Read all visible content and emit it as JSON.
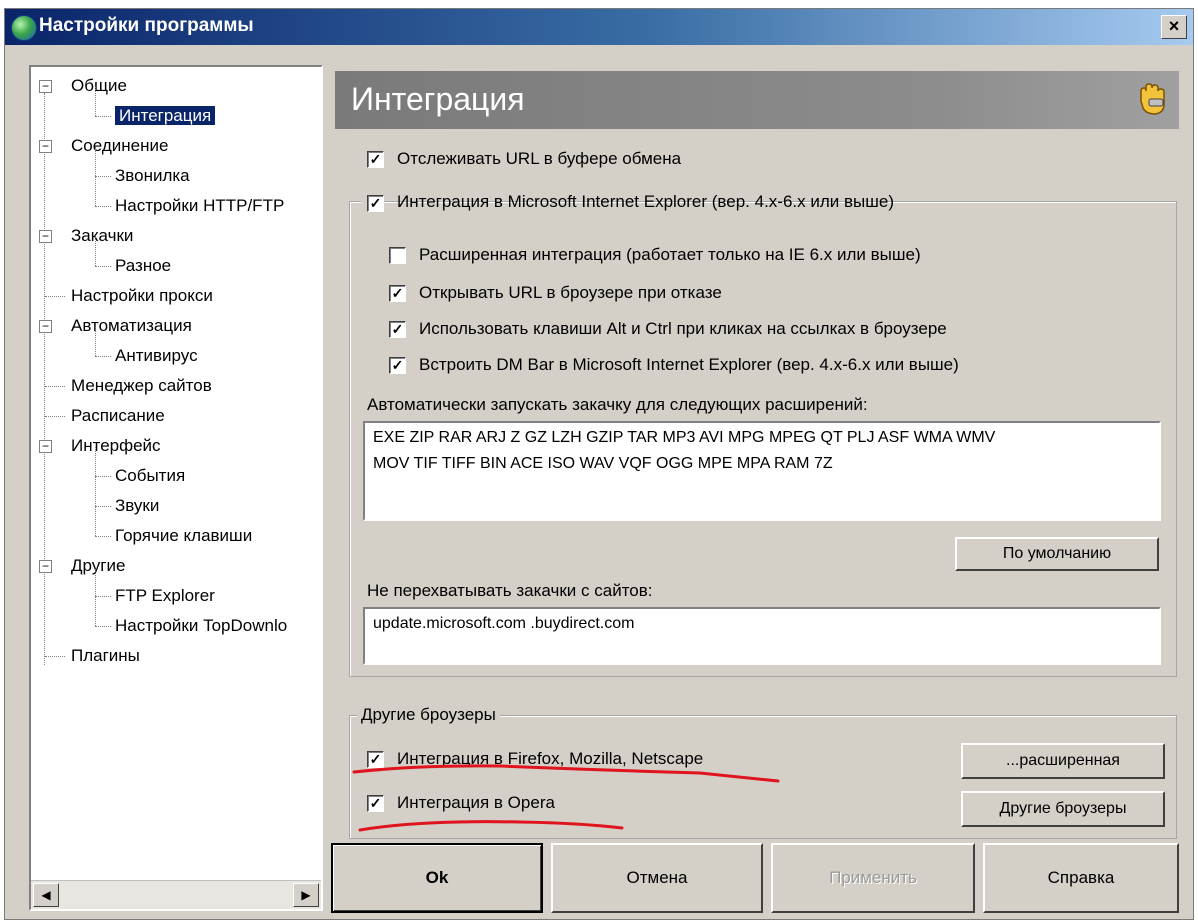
{
  "window": {
    "title": "Настройки программы",
    "close_label": "×"
  },
  "tree": {
    "items": [
      {
        "label": "Общие",
        "level": 0,
        "expander": "−"
      },
      {
        "label": "Интеграция",
        "level": 1
      },
      {
        "label": "Соединение",
        "level": 0,
        "expander": "−"
      },
      {
        "label": "Звонилка",
        "level": 1
      },
      {
        "label": "Настройки HTTP/FTP",
        "level": 1
      },
      {
        "label": "Закачки",
        "level": 0,
        "expander": "−"
      },
      {
        "label": "Разное",
        "level": 1
      },
      {
        "label": "Настройки прокси",
        "level": 0
      },
      {
        "label": "Автоматизация",
        "level": 0,
        "expander": "−"
      },
      {
        "label": "Антивирус",
        "level": 1
      },
      {
        "label": "Менеджер сайтов",
        "level": 0
      },
      {
        "label": "Расписание",
        "level": 0
      },
      {
        "label": "Интерфейс",
        "level": 0,
        "expander": "−"
      },
      {
        "label": "События",
        "level": 1
      },
      {
        "label": "Звуки",
        "level": 1
      },
      {
        "label": "Горячие клавиши",
        "level": 1
      },
      {
        "label": "Другие",
        "level": 0,
        "expander": "−"
      },
      {
        "label": "FTP Explorer",
        "level": 1
      },
      {
        "label": "Настройки TopDownlo",
        "level": 1
      },
      {
        "label": "Плагины",
        "level": 0
      }
    ],
    "scroll_left": "◀",
    "scroll_right": "▶"
  },
  "header": {
    "title": "Интеграция"
  },
  "options": {
    "track_clipboard": {
      "label": "Отслеживать URL в буфере обмена",
      "checked": true
    },
    "ie_integration": {
      "label": "Интеграция в Microsoft Internet Explorer (вер. 4.x-6.x или выше)",
      "checked": true
    },
    "extended": {
      "label": "Расширенная интеграция (работает только на IE 6.x или выше)",
      "checked": false
    },
    "open_url": {
      "label": "Открывать URL в броузере при отказе",
      "checked": true
    },
    "use_alt_ctrl": {
      "label": "Использовать клавиши Alt и Ctrl при кликах на ссылках в броузере",
      "checked": true
    },
    "dm_bar": {
      "label": "Встроить DM Bar в Microsoft Internet Explorer (вер. 4.x-6.x или выше)",
      "checked": true
    }
  },
  "extensions": {
    "label": "Автоматически запускать закачку для следующих расширений:",
    "line1": "EXE ZIP RAR ARJ Z GZ LZH GZIP TAR MP3 AVI MPG MPEG QT PLJ ASF WMA WMV",
    "line2": "MOV TIF TIFF BIN ACE ISO WAV VQF OGG MPE MPA RAM 7Z",
    "default_button": "По умолчанию"
  },
  "skip_sites": {
    "label": "Не перехватывать закачки с сайтов:",
    "value": "update.microsoft.com .buydirect.com"
  },
  "other_browsers": {
    "group_label": "Другие броузеры",
    "firefox": {
      "label": "Интеграция в Firefox, Mozilla, Netscape",
      "checked": true
    },
    "opera": {
      "label": "Интеграция в Opera",
      "checked": true
    },
    "advanced_button": "...расширенная",
    "other_button": "Другие броузеры"
  },
  "buttons": {
    "ok": "Ok",
    "cancel": "Отмена",
    "apply": "Применить",
    "help": "Справка"
  },
  "colors": {
    "annotation_red": "#e0141e",
    "selection": "#0a246a"
  }
}
